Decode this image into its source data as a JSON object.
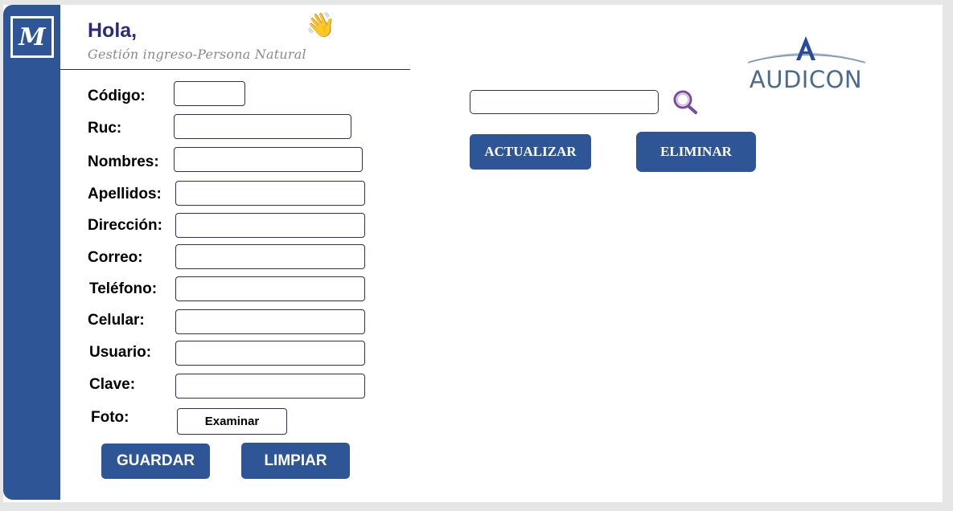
{
  "header": {
    "greeting": "Hola,",
    "wave_emoji": "👋",
    "subtitle": "Gestión ingreso-Persona Natural"
  },
  "sidebar": {
    "logo_letter": "M"
  },
  "brand": {
    "name": "AUDICON"
  },
  "form": {
    "fields": [
      {
        "label": "Código:",
        "value": ""
      },
      {
        "label": "Ruc:",
        "value": ""
      },
      {
        "label": "Nombres:",
        "value": ""
      },
      {
        "label": "Apellidos:",
        "value": ""
      },
      {
        "label": "Dirección:",
        "value": ""
      },
      {
        "label": "Correo:",
        "value": ""
      },
      {
        "label": "Teléfono:",
        "value": ""
      },
      {
        "label": "Celular:",
        "value": ""
      },
      {
        "label": "Usuario:",
        "value": ""
      },
      {
        "label": "Clave:",
        "value": ""
      }
    ],
    "photo_label": "Foto:",
    "browse_label": "Examinar",
    "save_label": "GUARDAR",
    "clear_label": "LIMPIAR"
  },
  "search": {
    "value": "",
    "icon": "search-icon"
  },
  "actions": {
    "update_label": "ACTUALIZAR",
    "delete_label": "ELIMINAR"
  },
  "colors": {
    "primary": "#2e5596",
    "greeting": "#2d2a7a",
    "search_icon": "#7a4a9e",
    "brand": "#4a6a8e",
    "brand_accent": "#2a4a9a"
  }
}
